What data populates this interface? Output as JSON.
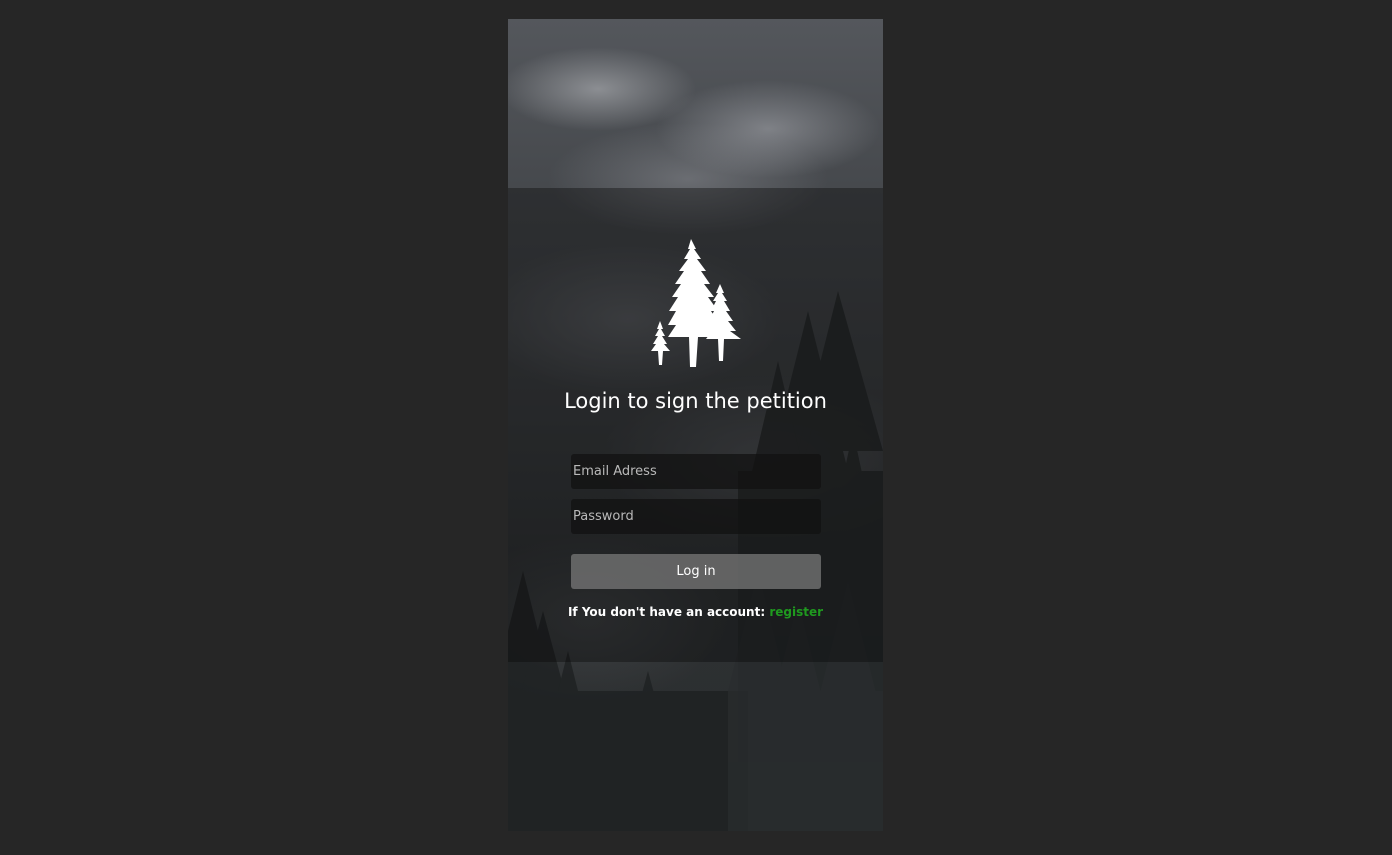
{
  "login": {
    "title": "Login to sign the petition",
    "email_placeholder": "Email Adress",
    "password_placeholder": "Password",
    "login_button_label": "Log in",
    "register_prompt": "If You don't have an account: ",
    "register_link_label": "register"
  },
  "colors": {
    "page_background": "#262626",
    "register_link": "#1f9a1f",
    "text": "#ffffff"
  },
  "icons": {
    "logo": "pine-tree-icon"
  }
}
